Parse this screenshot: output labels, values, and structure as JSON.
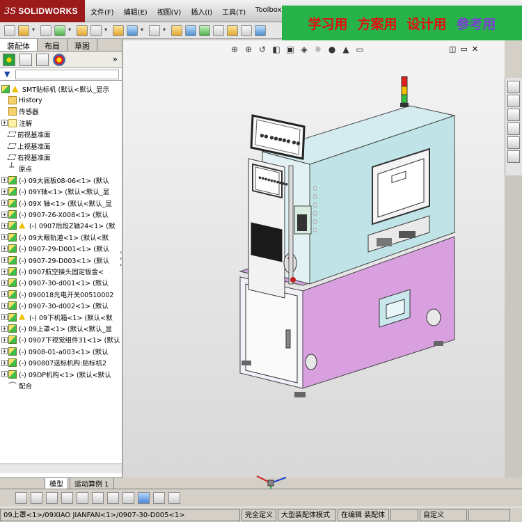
{
  "app": {
    "logo_ds": "3S",
    "logo_name": "SOLIDWORKS"
  },
  "menu": [
    "文件(F)",
    "编辑(E)",
    "视图(V)",
    "插入(I)",
    "工具(T)",
    "Toolbox"
  ],
  "banner": {
    "items": [
      "学习用",
      "方案用",
      "设计用",
      "参考用"
    ]
  },
  "left_panel": {
    "tabs": [
      "装配体",
      "布局",
      "草图"
    ],
    "expand_symbol": "»",
    "filter_symbol": "▼"
  },
  "tree": {
    "root": "SMT贴标机  (默认<默认_显示",
    "items": [
      {
        "icon": "folder-icon",
        "exp": "",
        "label": "History"
      },
      {
        "icon": "sensor-icon",
        "exp": "",
        "label": "传感器"
      },
      {
        "icon": "annotation-icon",
        "exp": "+",
        "label": "注解"
      },
      {
        "icon": "plane-icon",
        "exp": "",
        "label": "前视基准面"
      },
      {
        "icon": "plane-icon",
        "exp": "",
        "label": "上视基准面"
      },
      {
        "icon": "plane-icon",
        "exp": "",
        "label": "右视基准面"
      },
      {
        "icon": "origin-icon",
        "exp": "",
        "label": "原点"
      },
      {
        "icon": "assembly-icon",
        "exp": "+",
        "label": "(-) 09大底板08-06<1> (默认"
      },
      {
        "icon": "assembly-icon",
        "exp": "+",
        "label": "(-) 09Y轴<1>  (默认<默认_显"
      },
      {
        "icon": "assembly-icon",
        "exp": "+",
        "label": "(-) 09X 轴<1>  (默认<默认_显"
      },
      {
        "icon": "assembly-icon",
        "exp": "+",
        "label": "(-) 0907-26-X008<1> (默认"
      },
      {
        "icon": "warning-icon",
        "exp": "+",
        "label": "(-) 0907后段Z轴24<1> (默"
      },
      {
        "icon": "assembly-icon",
        "exp": "+",
        "label": "(-) 09大眼轨道<1> (默认<默"
      },
      {
        "icon": "assembly-icon",
        "exp": "+",
        "label": "(-) 0907-29-D001<1> (默认"
      },
      {
        "icon": "assembly-icon",
        "exp": "+",
        "label": "(-) 0907-29-D003<1> (默认"
      },
      {
        "icon": "assembly-icon",
        "exp": "+",
        "label": "(-) 0907航空接头固定钣金<"
      },
      {
        "icon": "assembly-icon",
        "exp": "+",
        "label": "(-) 0907-30-d001<1> (默认"
      },
      {
        "icon": "assembly-icon",
        "exp": "+",
        "label": "(-) 090018光电开关00510002"
      },
      {
        "icon": "assembly-icon",
        "exp": "+",
        "label": "(-) 0907-30-d002<1> (默认"
      },
      {
        "icon": "warning-icon",
        "exp": "+",
        "label": "(-) 09下机箱<1> (默认<默"
      },
      {
        "icon": "assembly-icon",
        "exp": "+",
        "label": "(-) 09上罩<1> (默认<默认_显"
      },
      {
        "icon": "assembly-icon",
        "exp": "+",
        "label": "(-) 0907下视觉组件31<1> (默认"
      },
      {
        "icon": "assembly-icon",
        "exp": "+",
        "label": "(-) 0908-01-a003<1> (默认"
      },
      {
        "icon": "assembly-icon",
        "exp": "+",
        "label": "(-) 090807送标机构:贴标机2"
      },
      {
        "icon": "assembly-icon",
        "exp": "+",
        "label": "(-) 09DP机构<1> (默认<默认"
      },
      {
        "icon": "mates-icon",
        "exp": "",
        "label": "配合"
      }
    ]
  },
  "bottom_tabs": [
    "模型",
    "运动算例 1"
  ],
  "status": {
    "path": "09上罩<1>/09XIAO JIANFAN<1>/0907-30-D005<1>",
    "state1": "完全定义",
    "state2": "大型装配体模式",
    "state3": "在编辑 装配体",
    "units": "自定义"
  },
  "colors": {
    "banner_bg": "#27b34a",
    "banner_text": "#e01010",
    "banner_text_alt": "#7a3fd0",
    "cabinet_upper": "#bfe3e6",
    "cabinet_lower": "#d9a0e0",
    "logo_bg": "#9b1b1b"
  }
}
